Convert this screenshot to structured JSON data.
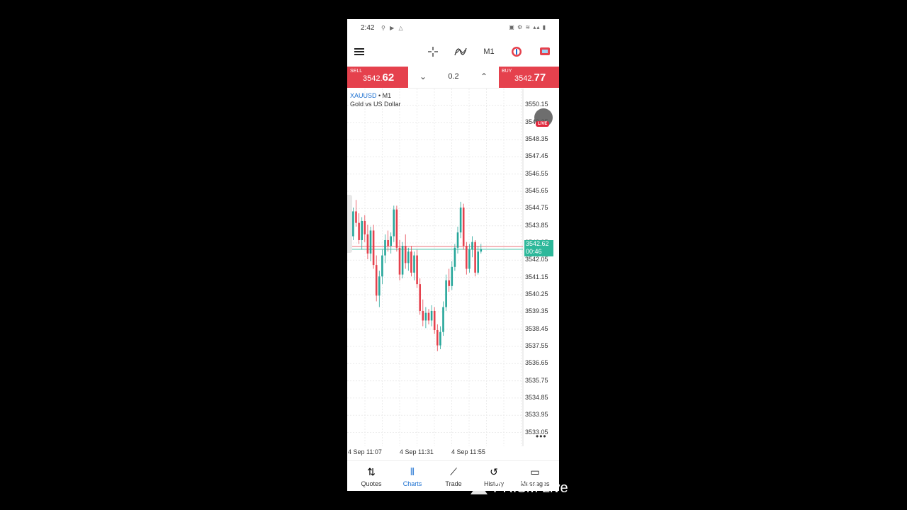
{
  "status_bar": {
    "time": "2:42",
    "left_icons": "⚲ ▶ △",
    "right_icons": "▣ ⚙ ≋ ▴▴ ▮"
  },
  "toolbar": {
    "crosshair_icon": "crosshair-icon",
    "indicator_icon": "indicator-icon",
    "timeframe": "M1",
    "trade_icon": "trade-icon",
    "chat_icon": "chat-icon"
  },
  "trade": {
    "sell_label": "SELL",
    "sell_price_small": "3542.",
    "sell_price_big": "62",
    "volume": "0.2",
    "buy_label": "BUY",
    "buy_price_small": "3542.",
    "buy_price_big": "77"
  },
  "chart": {
    "symbol": "XAUUSD",
    "symbol_sep": " • ",
    "timeframe": "M1",
    "description": "Gold vs US Dollar",
    "live_badge": "LIVE",
    "price_tag_price": "3542.62",
    "price_tag_timer": "00:46",
    "more_dots": "•••"
  },
  "chart_data": {
    "type": "candlestick",
    "y_ticks": [
      "3550.15",
      "3549.25",
      "3548.35",
      "3547.45",
      "3546.55",
      "3545.65",
      "3544.75",
      "3543.85",
      "3542.95",
      "3542.05",
      "3541.15",
      "3540.25",
      "3539.35",
      "3538.45",
      "3537.55",
      "3536.65",
      "3535.75",
      "3534.85",
      "3533.95",
      "3533.05"
    ],
    "ylim": [
      3532.7,
      3550.5
    ],
    "x_labels": [
      "4 Sep 11:07",
      "4 Sep 11:31",
      "4 Sep 11:55"
    ],
    "bid": 3542.62,
    "ask": 3542.77,
    "candles": [
      {
        "o": 3543.9,
        "h": 3544.2,
        "l": 3543.0,
        "c": 3543.3
      },
      {
        "o": 3543.3,
        "h": 3544.8,
        "l": 3543.1,
        "c": 3544.6
      },
      {
        "o": 3544.6,
        "h": 3545.2,
        "l": 3543.8,
        "c": 3544.0
      },
      {
        "o": 3544.0,
        "h": 3544.5,
        "l": 3542.9,
        "c": 3543.1
      },
      {
        "o": 3543.1,
        "h": 3544.3,
        "l": 3542.6,
        "c": 3544.1
      },
      {
        "o": 3544.1,
        "h": 3544.4,
        "l": 3543.0,
        "c": 3543.4
      },
      {
        "o": 3543.4,
        "h": 3543.9,
        "l": 3542.1,
        "c": 3542.4
      },
      {
        "o": 3542.4,
        "h": 3543.8,
        "l": 3542.0,
        "c": 3543.6
      },
      {
        "o": 3543.6,
        "h": 3543.9,
        "l": 3541.6,
        "c": 3541.8
      },
      {
        "o": 3541.8,
        "h": 3542.3,
        "l": 3539.9,
        "c": 3540.2
      },
      {
        "o": 3540.2,
        "h": 3541.5,
        "l": 3539.6,
        "c": 3541.2
      },
      {
        "o": 3541.2,
        "h": 3542.6,
        "l": 3540.8,
        "c": 3542.3
      },
      {
        "o": 3542.3,
        "h": 3543.4,
        "l": 3541.9,
        "c": 3543.1
      },
      {
        "o": 3543.1,
        "h": 3543.6,
        "l": 3542.5,
        "c": 3542.8
      },
      {
        "o": 3542.8,
        "h": 3543.5,
        "l": 3542.4,
        "c": 3543.3
      },
      {
        "o": 3543.3,
        "h": 3544.9,
        "l": 3543.0,
        "c": 3544.7
      },
      {
        "o": 3544.7,
        "h": 3544.9,
        "l": 3542.5,
        "c": 3542.7
      },
      {
        "o": 3542.7,
        "h": 3543.1,
        "l": 3541.0,
        "c": 3541.3
      },
      {
        "o": 3541.3,
        "h": 3543.0,
        "l": 3541.1,
        "c": 3542.8
      },
      {
        "o": 3542.8,
        "h": 3543.4,
        "l": 3541.6,
        "c": 3541.9
      },
      {
        "o": 3541.9,
        "h": 3542.7,
        "l": 3541.5,
        "c": 3542.5
      },
      {
        "o": 3542.5,
        "h": 3542.8,
        "l": 3541.2,
        "c": 3541.4
      },
      {
        "o": 3541.4,
        "h": 3542.5,
        "l": 3541.0,
        "c": 3542.3
      },
      {
        "o": 3542.3,
        "h": 3542.6,
        "l": 3540.6,
        "c": 3540.8
      },
      {
        "o": 3540.8,
        "h": 3541.1,
        "l": 3539.2,
        "c": 3539.4
      },
      {
        "o": 3539.4,
        "h": 3540.0,
        "l": 3538.6,
        "c": 3538.9
      },
      {
        "o": 3538.9,
        "h": 3539.6,
        "l": 3538.5,
        "c": 3539.3
      },
      {
        "o": 3539.3,
        "h": 3539.5,
        "l": 3538.7,
        "c": 3538.9
      },
      {
        "o": 3538.9,
        "h": 3539.7,
        "l": 3538.6,
        "c": 3539.4
      },
      {
        "o": 3539.4,
        "h": 3539.6,
        "l": 3538.2,
        "c": 3538.4
      },
      {
        "o": 3538.4,
        "h": 3538.7,
        "l": 3537.3,
        "c": 3537.6
      },
      {
        "o": 3537.6,
        "h": 3538.6,
        "l": 3537.4,
        "c": 3538.3
      },
      {
        "o": 3538.3,
        "h": 3539.9,
        "l": 3538.1,
        "c": 3539.6
      },
      {
        "o": 3539.6,
        "h": 3541.3,
        "l": 3539.4,
        "c": 3541.0
      },
      {
        "o": 3541.0,
        "h": 3541.6,
        "l": 3540.4,
        "c": 3540.7
      },
      {
        "o": 3540.7,
        "h": 3542.0,
        "l": 3540.5,
        "c": 3541.7
      },
      {
        "o": 3541.7,
        "h": 3542.9,
        "l": 3541.5,
        "c": 3542.7
      },
      {
        "o": 3542.7,
        "h": 3543.8,
        "l": 3542.4,
        "c": 3543.5
      },
      {
        "o": 3543.5,
        "h": 3545.1,
        "l": 3543.2,
        "c": 3544.8
      },
      {
        "o": 3544.8,
        "h": 3545.0,
        "l": 3542.6,
        "c": 3542.8
      },
      {
        "o": 3542.8,
        "h": 3543.0,
        "l": 3541.3,
        "c": 3541.6
      },
      {
        "o": 3541.6,
        "h": 3542.9,
        "l": 3541.4,
        "c": 3542.6
      },
      {
        "o": 3542.6,
        "h": 3543.3,
        "l": 3542.2,
        "c": 3543.0
      },
      {
        "o": 3543.0,
        "h": 3543.1,
        "l": 3541.2,
        "c": 3541.4
      },
      {
        "o": 3541.4,
        "h": 3542.8,
        "l": 3541.3,
        "c": 3542.5
      },
      {
        "o": 3542.5,
        "h": 3542.9,
        "l": 3542.4,
        "c": 3542.62
      }
    ]
  },
  "nav": [
    {
      "label": "Quotes",
      "icon": "quotes-icon",
      "glyph": "⇅"
    },
    {
      "label": "Charts",
      "icon": "charts-icon",
      "glyph": "⫴"
    },
    {
      "label": "Trade",
      "icon": "trade-nav-icon",
      "glyph": "⟋"
    },
    {
      "label": "History",
      "icon": "history-icon",
      "glyph": "↺"
    },
    {
      "label": "Messages",
      "icon": "messages-icon",
      "glyph": "▭"
    }
  ],
  "watermark": "PRISM Live",
  "colors": {
    "bull": "#26a69a",
    "bear": "#e5414d",
    "sell_bg": "#e5414d",
    "buy_bg": "#e5414d",
    "accent": "#1a6fd0"
  }
}
